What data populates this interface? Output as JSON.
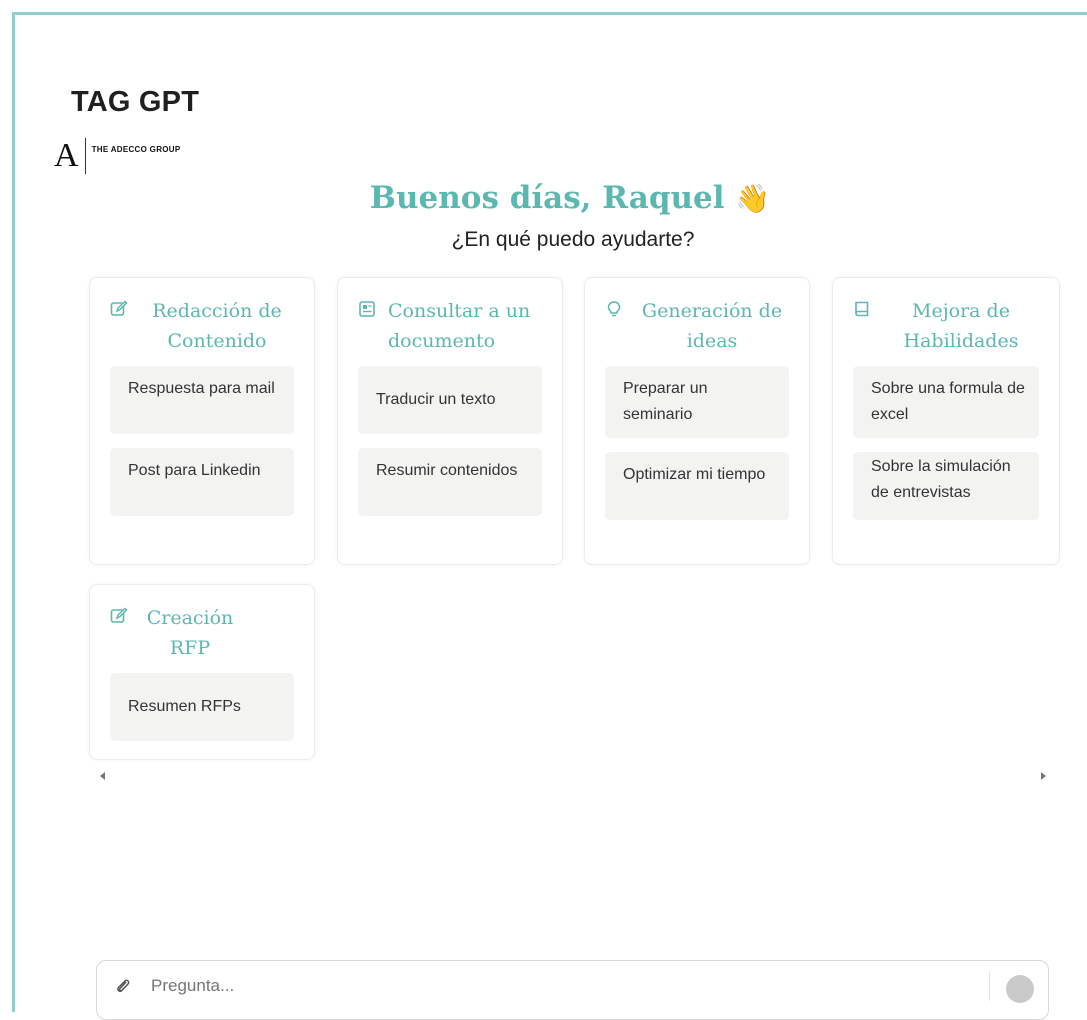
{
  "app": {
    "title": "TAG GPT",
    "logo_mark": "A",
    "logo_text": "THE ADECCO GROUP"
  },
  "greeting": {
    "title": "Buenos días, Raquel",
    "emoji": "👋",
    "subtitle": "¿En qué puedo ayudarte?"
  },
  "cards": [
    {
      "icon": "edit-icon",
      "title": "Redacción de Contenido",
      "prompts": [
        "Respuesta para mail",
        "Post para Linkedin"
      ]
    },
    {
      "icon": "document-icon",
      "title": "Consultar a un documento",
      "prompts": [
        "Traducir un texto",
        "Resumir contenidos"
      ]
    },
    {
      "icon": "lightbulb-icon",
      "title": "Generación de ideas",
      "prompts": [
        "Preparar un seminario",
        "Optimizar mi tiempo"
      ]
    },
    {
      "icon": "book-icon",
      "title": "Mejora de Habilidades",
      "prompts": [
        "Sobre una formula de excel",
        "Sobre la simulación de entrevistas"
      ]
    },
    {
      "icon": "edit-icon",
      "title": "Creación RFP",
      "prompts": [
        "Resumen RFPs"
      ]
    }
  ],
  "input": {
    "value": "",
    "placeholder": "Pregunta..."
  },
  "colors": {
    "accent": "#5bb8b0",
    "frame_border": "#8fd0c9",
    "prompt_bg": "#f3f3f2"
  }
}
